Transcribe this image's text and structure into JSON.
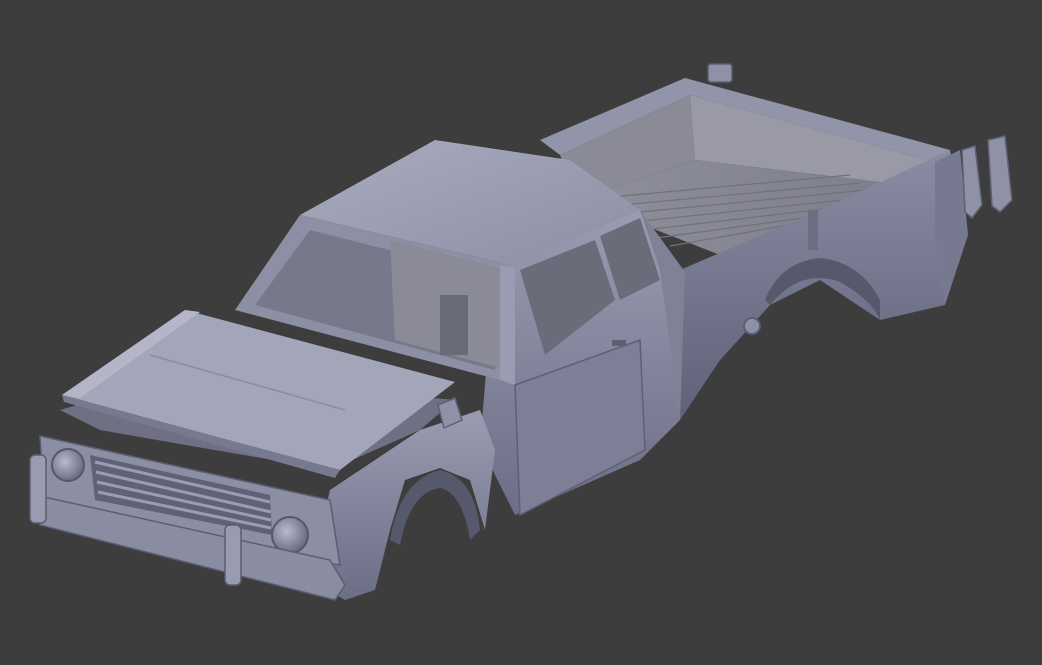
{
  "viewport": {
    "subject": "truck-body-3d-model",
    "background_color": "#3d3d3d",
    "model_base_color": "#8a8ca3",
    "model_highlight_color": "#b2b4c6",
    "model_shadow_color": "#5d5f75",
    "interior_color": "#8e8f9a"
  }
}
